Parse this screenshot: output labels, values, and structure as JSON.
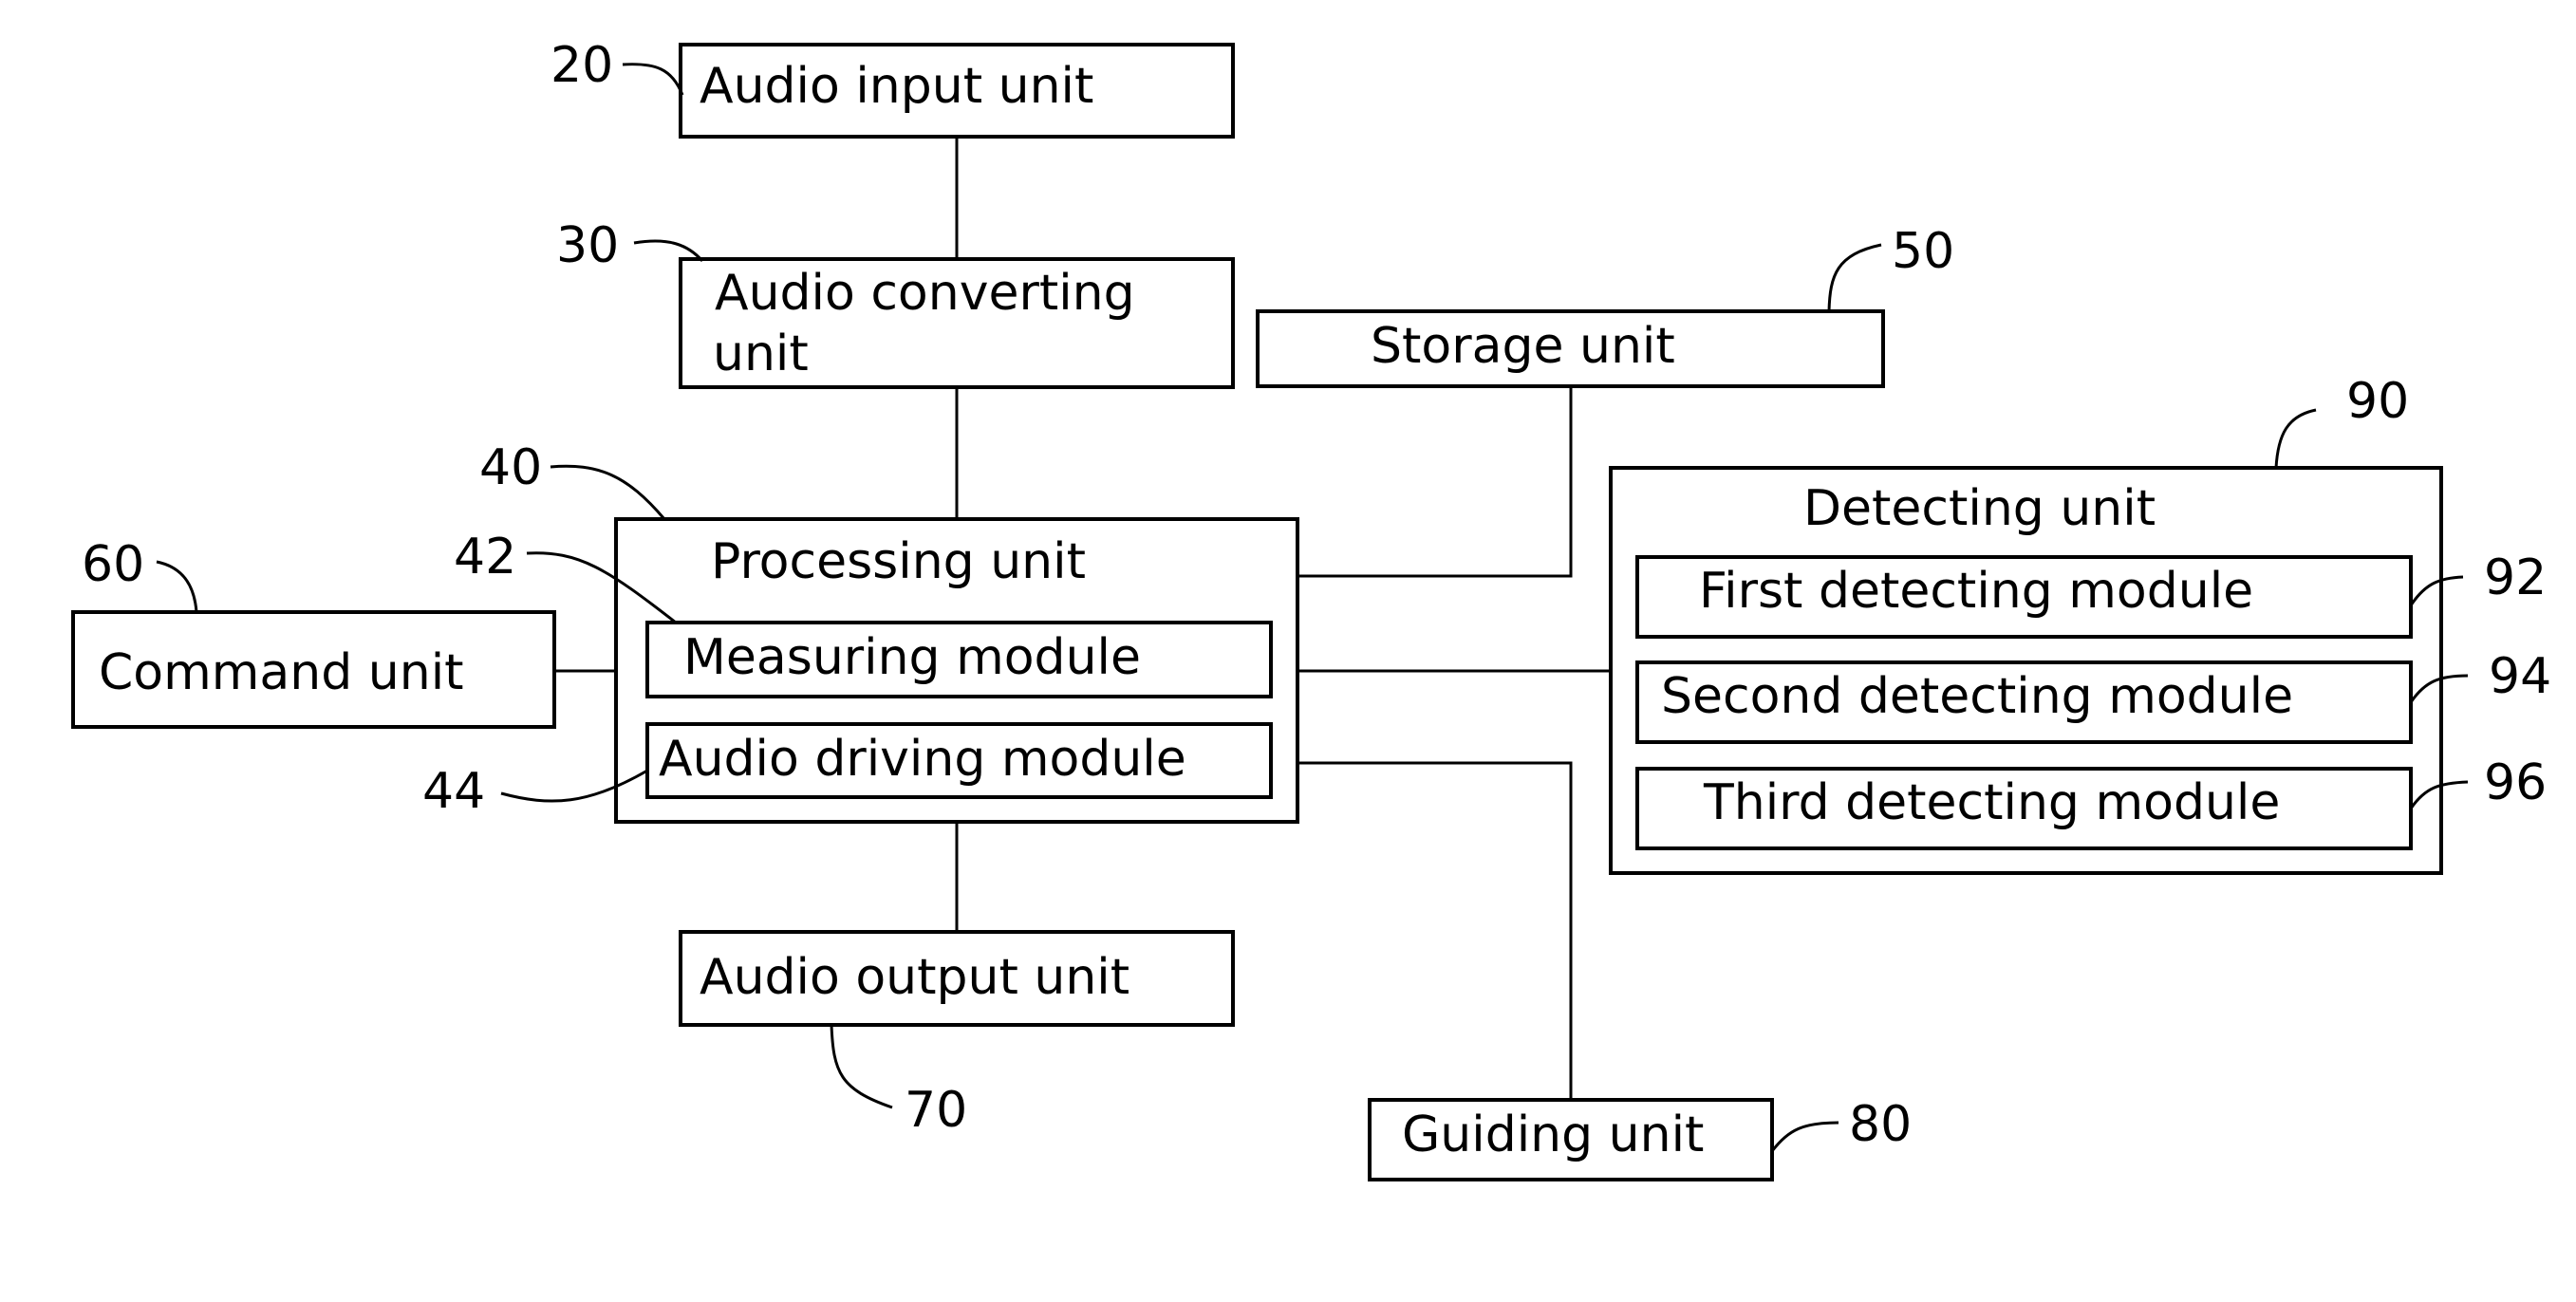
{
  "diagram": {
    "blocks": {
      "audio_input": {
        "ref": "20",
        "label": "Audio input unit"
      },
      "audio_converting": {
        "ref": "30",
        "label_line1": "Audio converting",
        "label_line2": "unit"
      },
      "storage": {
        "ref": "50",
        "label": "Storage unit"
      },
      "processing": {
        "ref": "40",
        "label": "Processing unit"
      },
      "measuring": {
        "ref": "42",
        "label": "Measuring module"
      },
      "audio_driving": {
        "ref": "44",
        "label": "Audio driving module"
      },
      "command": {
        "ref": "60",
        "label": "Command unit"
      },
      "audio_output": {
        "ref": "70",
        "label": "Audio output unit"
      },
      "guiding": {
        "ref": "80",
        "label": "Guiding unit"
      },
      "detecting": {
        "ref": "90",
        "label": "Detecting unit"
      },
      "first_detecting": {
        "ref": "92",
        "label": "First detecting module"
      },
      "second_detecting": {
        "ref": "94",
        "label": "Second detecting module"
      },
      "third_detecting": {
        "ref": "96",
        "label": "Third detecting module"
      }
    },
    "connections": [
      [
        "audio_input",
        "audio_converting"
      ],
      [
        "audio_converting",
        "processing"
      ],
      [
        "storage",
        "processing"
      ],
      [
        "command",
        "processing"
      ],
      [
        "processing",
        "detecting"
      ],
      [
        "processing",
        "guiding"
      ],
      [
        "processing",
        "audio_output"
      ]
    ]
  }
}
